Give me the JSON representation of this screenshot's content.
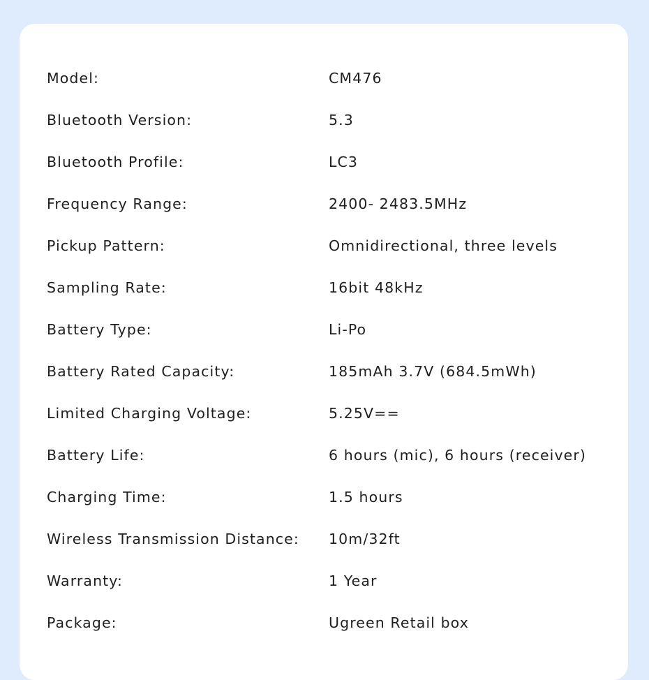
{
  "colors": {
    "page_background": "#deecfd",
    "card_background": "#ffffff",
    "text": "#1f1f1f"
  },
  "specs": [
    {
      "label": "Model:",
      "value": "CM476"
    },
    {
      "label": "Bluetooth Version:",
      "value": "5.3"
    },
    {
      "label": "Bluetooth Profile:",
      "value": "LC3"
    },
    {
      "label": "Frequency Range:",
      "value": "2400- 2483.5MHz"
    },
    {
      "label": "Pickup Pattern:",
      "value": "Omnidirectional, three levels"
    },
    {
      "label": "Sampling Rate:",
      "value": "16bit 48kHz"
    },
    {
      "label": "Battery Type:",
      "value": "Li-Po"
    },
    {
      "label": "Battery Rated Capacity:",
      "value": "185mAh 3.7V (684.5mWh)"
    },
    {
      "label": "Limited Charging Voltage:",
      "value": "5.25V=="
    },
    {
      "label": "Battery Life:",
      "value": "6 hours (mic), 6 hours (receiver)"
    },
    {
      "label": "Charging Time:",
      "value": "1.5 hours"
    },
    {
      "label": "Wireless Transmission Distance:",
      "value": "10m/32ft"
    },
    {
      "label": "Warranty:",
      "value": "1 Year"
    },
    {
      "label": "Package:",
      "value": "Ugreen Retail box"
    }
  ]
}
